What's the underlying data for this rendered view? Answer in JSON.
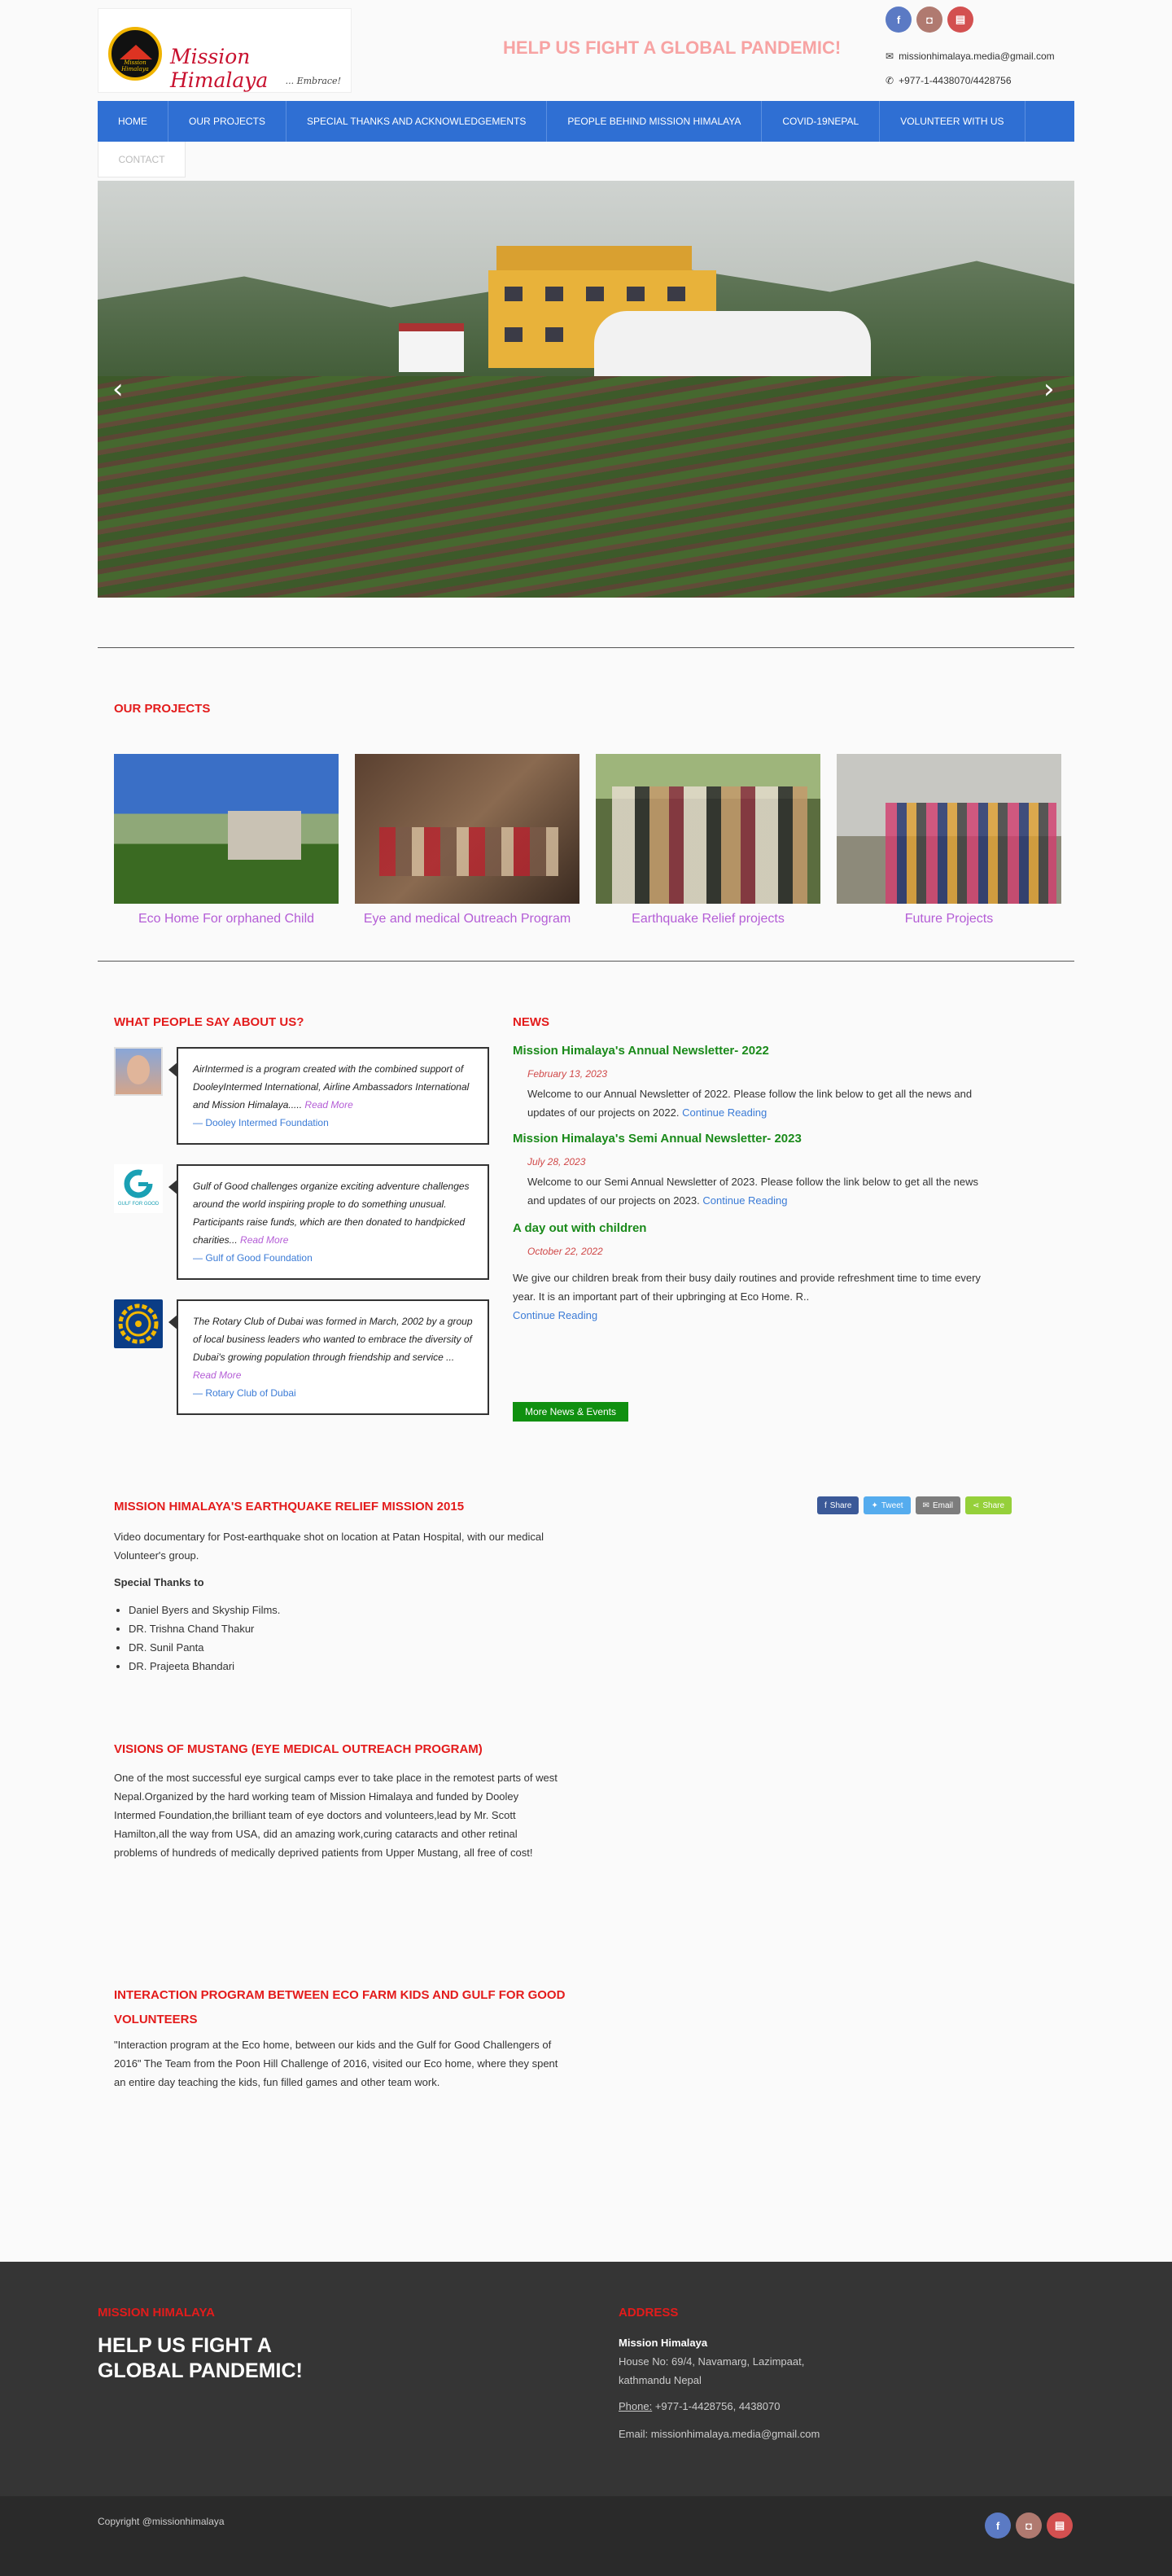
{
  "header": {
    "logo_title": "Mission Himalaya",
    "logo_tag": "... Embrace!",
    "logo_badge": "Mission Himalaya",
    "headline": "HELP US FIGHT A GLOBAL PANDEMIC!",
    "email": "missionhimalaya.media@gmail.com",
    "phone": "+977-1-4438070/4428756",
    "social": [
      "f",
      "◘",
      "▤"
    ]
  },
  "nav": {
    "items": [
      "HOME",
      "OUR PROJECTS",
      "SPECIAL THANKS AND ACKNOWLEDGEMENTS",
      "PEOPLE BEHIND MISSION HIMALAYA",
      "COVID-19NEPAL",
      "VOLUNTEER WITH US"
    ],
    "contact": "CONTACT"
  },
  "slider": {
    "prev": "‹",
    "next": "›"
  },
  "projects": {
    "title": "OUR PROJECTS",
    "items": [
      "Eco Home For orphaned Child",
      "Eye and medical Outreach Program",
      "Earthquake Relief projects",
      "Future Projects"
    ]
  },
  "testimonials": {
    "title": "WHAT PEOPLE SAY ABOUT US?",
    "items": [
      {
        "text": "AirIntermed is a program created with the combined support of DooleyIntermed International, Airline Ambassadors International and Mission Himalaya.....",
        "read_more": "Read More",
        "author": "— Dooley Intermed Foundation"
      },
      {
        "text": "Gulf of Good challenges organize exciting adventure challenges around the world inspiring prople to do something unusual. Participants raise funds, which are then donated to handpicked charities...",
        "read_more": "Read More",
        "author": "— Gulf of Good Foundation"
      },
      {
        "text": "The Rotary Club of Dubai was formed in March, 2002 by a group of local business leaders who wanted to embrace the diversity of Dubai's growing population through friendship and service ...",
        "read_more": "Read More",
        "author": "— Rotary Club of Dubai"
      }
    ],
    "logo_gulf": "GULF FOR GOOD"
  },
  "news": {
    "title": "NEWS",
    "items": [
      {
        "title": "Mission Himalaya's Annual Newsletter- 2022",
        "date": "February 13, 2023",
        "body": "Welcome to our Annual Newsletter of 2022. Please follow the link below to get all the news and updates of our projects on 2022.",
        "link": "Continue Reading"
      },
      {
        "title": "Mission Himalaya's Semi Annual Newsletter- 2023",
        "date": "July 28, 2023",
        "body": "Welcome to our Semi Annual Newsletter of 2023. Please follow the link below to get all the news and updates of our projects on 2023.",
        "link": "Continue Reading"
      },
      {
        "title": "A day out with children",
        "date": "October 22, 2022",
        "body": "We give our children break from their busy daily routines and provide refreshment time to time every year. It is an important part of their upbringing at Eco Home. R..",
        "link": "Continue Reading"
      }
    ],
    "more": "More News & Events"
  },
  "share": {
    "facebook": "Share",
    "twitter": "Tweet",
    "email": "Email",
    "share": "Share"
  },
  "earthquake": {
    "title": "MISSION HIMALAYA'S EARTHQUAKE RELIEF MISSION 2015",
    "body": "Video documentary for Post-earthquake shot on location at Patan Hospital, with our medical Volunteer's group.",
    "thanks_heading": "Special Thanks to",
    "thanks": [
      "Daniel Byers and Skyship Films.",
      "DR. Trishna Chand Thakur",
      "DR. Sunil Panta",
      "DR. Prajeeta Bhandari"
    ]
  },
  "mustang": {
    "title": "VISIONS OF MUSTANG (EYE MEDICAL OUTREACH PROGRAM)",
    "body": "One of the most successful eye surgical camps ever to take place in the remotest parts of west Nepal.Organized by the hard working team of Mission Himalaya and funded by Dooley Intermed Foundation,the brilliant team of eye doctors and volunteers,lead by Mr. Scott Hamilton,all the way from USA, did an amazing work,curing cataracts and other retinal problems of hundreds of medically deprived patients from Upper Mustang, all free of cost!"
  },
  "interaction": {
    "title": "INTERACTION PROGRAM BETWEEN ECO FARM KIDS AND GULF FOR GOOD VOLUNTEERS",
    "body": "\"Interaction program at the Eco home, between our kids and the Gulf for Good Challengers of 2016\" The Team from the Poon Hill Challenge of 2016, visited our Eco home, where they spent an entire day teaching the kids, fun filled games and other team work."
  },
  "footer": {
    "left_title": "MISSION HIMALAYA",
    "left_big": "HELP US FIGHT A GLOBAL PANDEMIC!",
    "right_title": "ADDRESS",
    "org": "Mission Himalaya",
    "address1": "House No: 69/4, Navamarg, Lazimpaat,",
    "address2": "kathmandu Nepal",
    "phone_label": "Phone:",
    "phone": " +977-1-4428756, 4438070",
    "email": "Email: missionhimalaya.media@gmail.com",
    "copyright": "Copyright @missionhimalaya"
  }
}
